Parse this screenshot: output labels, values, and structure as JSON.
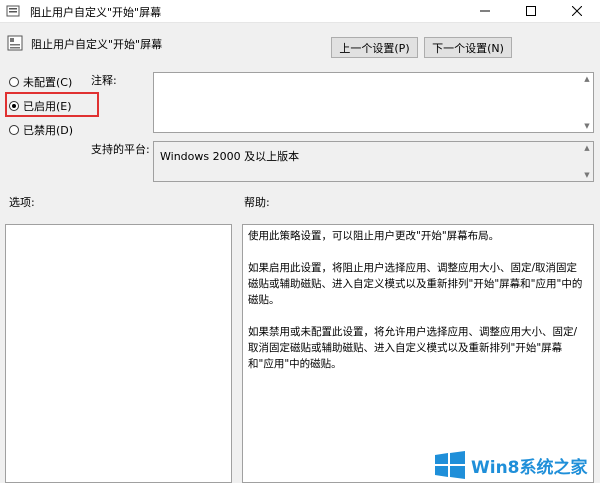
{
  "window": {
    "title": "阻止用户自定义\"开始\"屏幕",
    "minimize_icon": "minimize-icon",
    "maximize_icon": "maximize-icon",
    "close_icon": "close-icon"
  },
  "header": {
    "policy_title": "阻止用户自定义\"开始\"屏幕",
    "prev_button": "上一个设置(P)",
    "next_button": "下一个设置(N)"
  },
  "radios": [
    {
      "label": "未配置(C)",
      "checked": false
    },
    {
      "label": "已启用(E)",
      "checked": true
    },
    {
      "label": "已禁用(D)",
      "checked": false
    }
  ],
  "fields": {
    "note_label": "注释:",
    "note_value": "",
    "platform_label": "支持的平台:",
    "platform_value": "Windows 2000 及以上版本"
  },
  "sections": {
    "options_label": "选项:",
    "help_label": "帮助:"
  },
  "help_paragraphs": [
    "使用此策略设置，可以阻止用户更改\"开始\"屏幕布局。",
    "如果启用此设置，将阻止用户选择应用、调整应用大小、固定/取消固定磁贴或辅助磁贴、进入自定义模式以及重新排列\"开始\"屏幕和\"应用\"中的磁贴。",
    "如果禁用或未配置此设置，将允许用户选择应用、调整应用大小、固定/取消固定磁贴或辅助磁贴、进入自定义模式以及重新排列\"开始\"屏幕和\"应用\"中的磁贴。"
  ],
  "watermark": {
    "text": "Win8系统之家"
  },
  "colors": {
    "highlight": "#e03131",
    "watermark_blue": "#1f8fd9"
  }
}
